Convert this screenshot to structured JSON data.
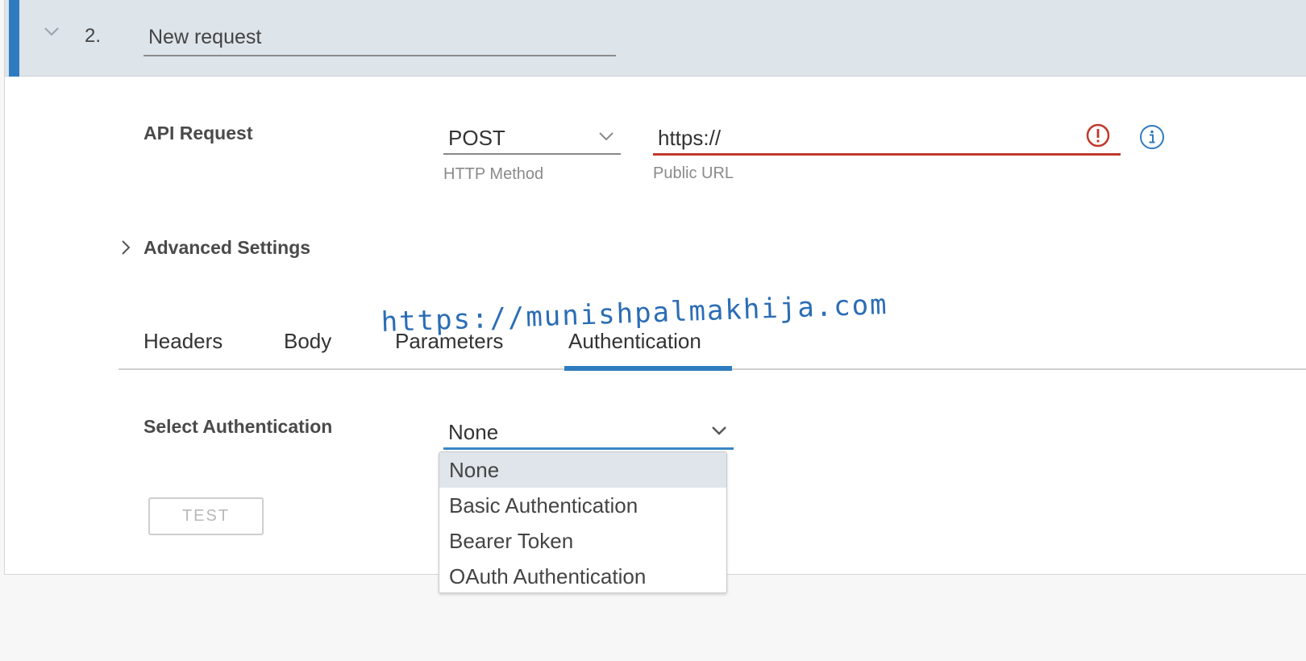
{
  "step": {
    "number": "2.",
    "name": "New request"
  },
  "api_request": {
    "label": "API Request",
    "method": {
      "value": "POST",
      "helper": "HTTP Method"
    },
    "url": {
      "value": "https://",
      "helper": "Public URL",
      "state": "error"
    }
  },
  "advanced": {
    "label": "Advanced Settings",
    "expanded": false
  },
  "tabs": [
    {
      "label": "Headers",
      "active": false
    },
    {
      "label": "Body",
      "active": false
    },
    {
      "label": "Parameters",
      "active": false
    },
    {
      "label": "Authentication",
      "active": true
    }
  ],
  "authentication": {
    "label": "Select Authentication",
    "selected": "None",
    "options": [
      "None",
      "Basic Authentication",
      "Bearer Token",
      "OAuth Authentication"
    ]
  },
  "test_button": {
    "label": "TEST",
    "disabled": true
  },
  "watermark": "https://munishpalmakhija.com",
  "icons": {
    "collapse": "chevron-down-icon",
    "dropdown": "chevron-down-icon",
    "error": "error-circle-icon",
    "info": "info-icon",
    "expand": "chevron-right-icon"
  },
  "colors": {
    "accent": "#2f7bbf",
    "error": "#c0392b",
    "header_band": "#dde4ea",
    "selected_option": "#dfe5ea"
  }
}
